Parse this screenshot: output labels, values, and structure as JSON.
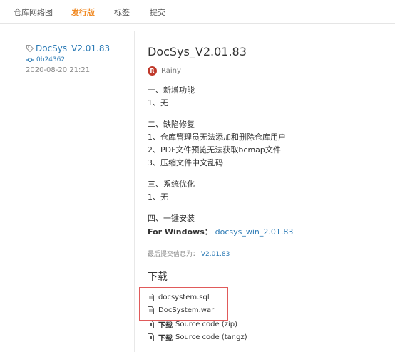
{
  "tabs": [
    {
      "label": "仓库网络图",
      "active": false
    },
    {
      "label": "发行版",
      "active": true
    },
    {
      "label": "标签",
      "active": false
    },
    {
      "label": "提交",
      "active": false
    }
  ],
  "sidebar": {
    "tag": "DocSys_V2.01.83",
    "commit": "0b24362",
    "date": "2020-08-20 21:21"
  },
  "release": {
    "title": "DocSys_V2.01.83",
    "author_initial": "R",
    "author": "Rainy",
    "notes": [
      "一、新增功能",
      "1、无",
      "二、缺陷修复",
      "1、仓库管理员无法添加和删除仓库用户",
      "2、PDF文件预览无法获取bcmap文件",
      "3、压缩文件中文乱码",
      "三、系统优化",
      "1、无",
      "四、一键安装"
    ],
    "windows_label": "For Windows：",
    "windows_file": "docsys_win_2.01.83",
    "last_commit_label": "最后提交信息为：",
    "last_commit_value": "V2.01.83"
  },
  "download": {
    "title": "下载",
    "files": [
      {
        "name": "docsystem.sql"
      },
      {
        "name": "DocSystem.war"
      },
      {
        "prefix": "下载",
        "name": "Source code (zip)"
      },
      {
        "prefix": "下载",
        "name": "Source code (tar.gz)"
      }
    ]
  },
  "colors": {
    "accent": "#f08a24",
    "link": "#2b7ab5",
    "avatar": "#c0392b",
    "highlight": "#e05a5a"
  }
}
